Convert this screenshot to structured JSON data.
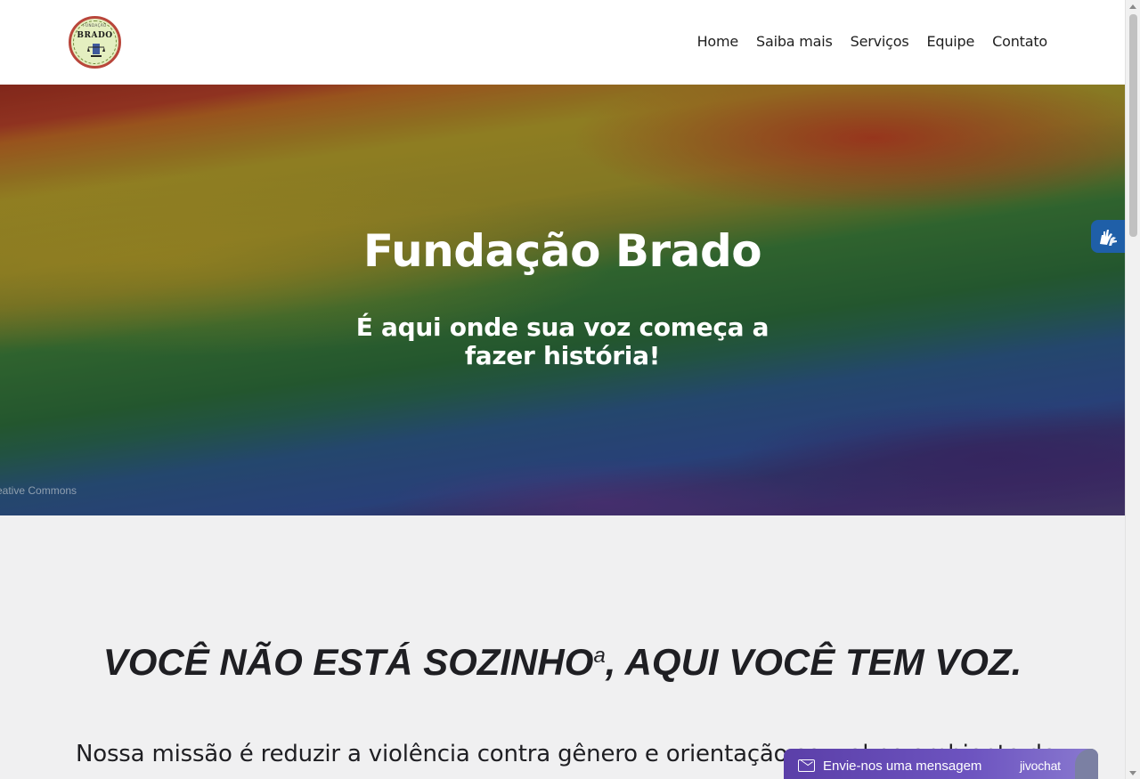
{
  "header": {
    "logo": {
      "text": "BRADO",
      "subtext": "FUNDAÇÃO",
      "colors": {
        "ring": "#b9463b",
        "fill": "#e4efc0"
      }
    },
    "nav": [
      {
        "label": "Home"
      },
      {
        "label": "Saiba mais"
      },
      {
        "label": "Serviços"
      },
      {
        "label": "Equipe"
      },
      {
        "label": "Contato"
      }
    ]
  },
  "hero": {
    "title": "Fundação Brado",
    "subtitle": "É aqui onde sua voz começa a fazer história!",
    "image_credit": "eative Commons",
    "background": "rainbow-flag"
  },
  "accessibility": {
    "icon": "sign-language-hands-icon",
    "color": "#1f5fa8"
  },
  "content": {
    "tagline_main": "VOCÊ NÃO ESTÁ SOZINHO",
    "tagline_sup": "a",
    "tagline_rest": ", AQUI VOCÊ TEM VOZ.",
    "mission": "Nossa missão é reduzir a violência contra gênero e orientação sexual no ambiente de"
  },
  "chat": {
    "label": "Envie-nos uma mensagem",
    "brand": "jivochat",
    "icon": "envelope-icon",
    "color": "#5b3fa8"
  }
}
